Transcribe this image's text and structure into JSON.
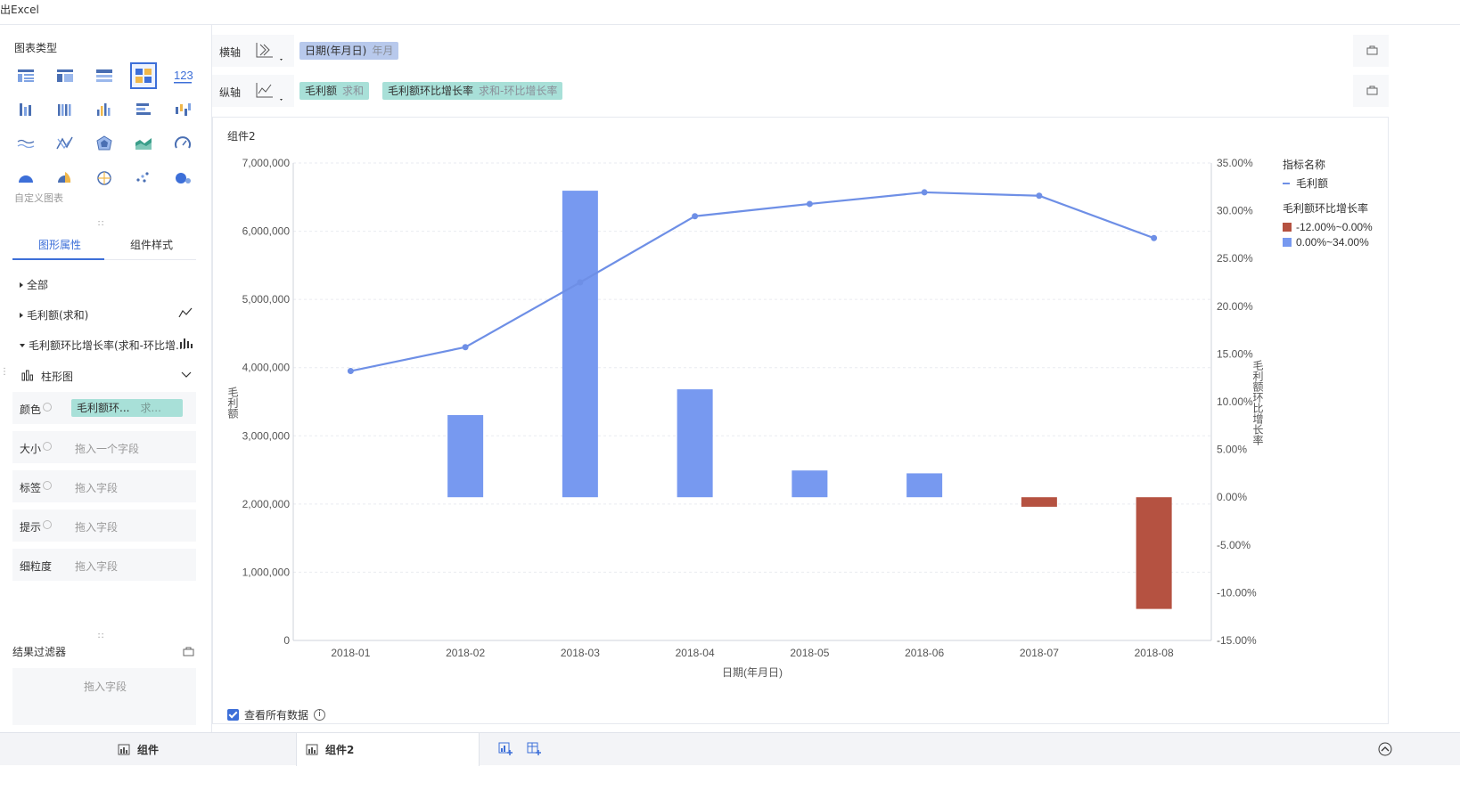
{
  "topbar": {
    "export_label": "出Excel"
  },
  "left_panel": {
    "chart_types_title": "图表类型",
    "custom_chart_label": "自定义图表",
    "tabs": [
      "图形属性",
      "组件样式"
    ],
    "tree": {
      "all": "全部",
      "measure1": "毛利额(求和)",
      "measure2": "毛利额环比增长率(求和-环比增...",
      "mark_type": "柱形图"
    },
    "props": [
      {
        "label": "颜色",
        "chip_main": "毛利额环...",
        "chip_sub": "求..."
      },
      {
        "label": "大小",
        "placeholder": "拖入一个字段"
      },
      {
        "label": "标签",
        "placeholder": "拖入字段"
      },
      {
        "label": "提示",
        "placeholder": "拖入字段"
      },
      {
        "label": "细粒度",
        "placeholder": "拖入字段"
      }
    ],
    "filter_title": "结果过滤器",
    "filter_placeholder": "拖入字段"
  },
  "axes": {
    "x_label": "横轴",
    "x_pill_main": "日期(年月日)",
    "x_pill_sub": "年月",
    "y_label": "纵轴",
    "y_pill1_main": "毛利额",
    "y_pill1_sub": "求和",
    "y_pill2_main": "毛利额环比增长率",
    "y_pill2_sub": "求和-环比增长率"
  },
  "chart_card": {
    "name": "组件2",
    "view_all_label": "查看所有数据"
  },
  "chart_data": {
    "type": "bar",
    "categories": [
      "2018-01",
      "2018-02",
      "2018-03",
      "2018-04",
      "2018-05",
      "2018-06",
      "2018-07",
      "2018-08"
    ],
    "xlabel": "日期(年月日)",
    "ylabel_left": "毛利额",
    "ylabel_right": "毛利额环比增长率",
    "ylim_left": [
      0,
      7000000
    ],
    "yticks_left": [
      "0",
      "1,000,000",
      "2,000,000",
      "3,000,000",
      "4,000,000",
      "5,000,000",
      "6,000,000",
      "7,000,000"
    ],
    "ylim_right": [
      -15,
      35
    ],
    "yticks_right": [
      "-15.00%",
      "-10.00%",
      "-5.00%",
      "0.00%",
      "5.00%",
      "10.00%",
      "15.00%",
      "20.00%",
      "25.00%",
      "30.00%",
      "35.00%"
    ],
    "series": [
      {
        "name": "毛利额",
        "type": "line",
        "axis": "left",
        "color": "#6e8fe6",
        "values": [
          3950000,
          4300000,
          5250000,
          6220000,
          6400000,
          6570000,
          6520000,
          5900000
        ]
      },
      {
        "name": "毛利额环比增长率",
        "type": "bar",
        "axis": "right",
        "values": [
          null,
          8.6,
          32.1,
          11.3,
          2.8,
          2.5,
          -1.0,
          -11.7
        ]
      }
    ],
    "legend": {
      "position": "right",
      "title1": "指标名称",
      "line_item": "毛利额",
      "title2": "毛利额环比增长率",
      "ranges": [
        {
          "label": "-12.00%~0.00%",
          "color": "#b55241"
        },
        {
          "label": "0.00%~34.00%",
          "color": "#7799f0"
        }
      ]
    },
    "grid": true
  },
  "bottom_tabs": [
    "组件",
    "组件2"
  ]
}
